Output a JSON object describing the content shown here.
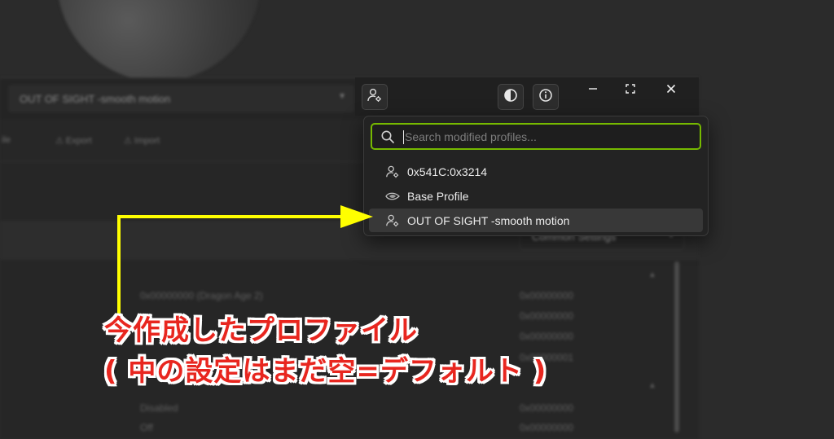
{
  "background": {
    "profile_select_text": "OUT OF SIGHT -smooth motion",
    "toolbar": {
      "left_cut_label": "ile",
      "export_label": "Export",
      "import_label": "Import"
    },
    "common_settings_label": "Common Settings",
    "rows": [
      "0x00000000 (Dragon Age 2)",
      "0x00000000",
      "0x00000000",
      "0x00000000",
      "0x00000001",
      "Disabled",
      "Off",
      "0x00000000",
      "0x00000000"
    ]
  },
  "titlebar": {
    "icons": [
      "profile-settings-icon",
      "contrast-icon",
      "info-icon"
    ],
    "window_controls": [
      "minimize",
      "maximize",
      "close"
    ]
  },
  "dropdown": {
    "search": {
      "placeholder": "Search modified profiles...",
      "value": ""
    },
    "items": [
      {
        "label": "0x541C:0x3214",
        "icon": "user-gear-icon",
        "selected": false
      },
      {
        "label": "Base Profile",
        "icon": "nvidia-icon",
        "selected": false
      },
      {
        "label": "OUT OF SIGHT -smooth motion",
        "icon": "user-gear-icon",
        "selected": true
      }
    ],
    "accent": "#76b900"
  },
  "annotation": {
    "line1": "今作成したプロファイル",
    "line2": "( 中の設定はまだ空=デフォルト )",
    "arrow_color": "#ffff00",
    "text_color": "#e8261f"
  }
}
